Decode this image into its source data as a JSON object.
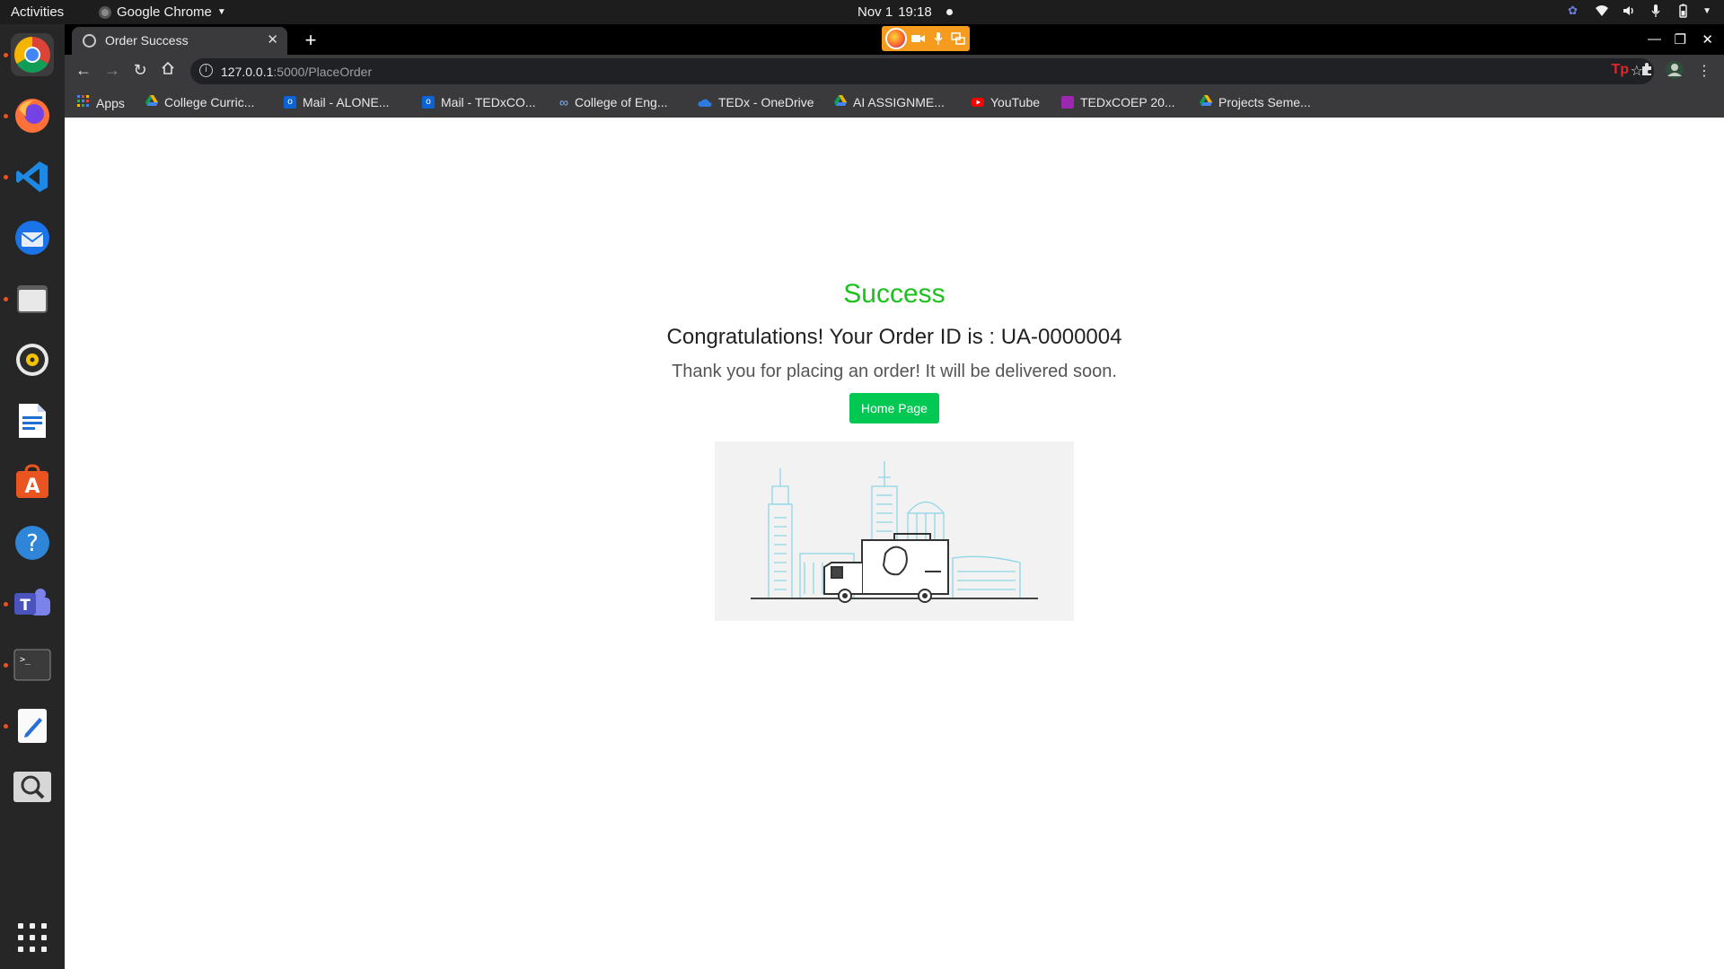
{
  "topbar": {
    "activities": "Activities",
    "app_name": "Google Chrome",
    "date": "Nov 1",
    "time": "19:18"
  },
  "dock": {
    "items": [
      "chrome-icon",
      "firefox-icon",
      "vscode-icon",
      "thunderbird-icon",
      "files-icon",
      "rhythmbox-icon",
      "libreoffice-writer-icon",
      "software-center-icon",
      "help-icon",
      "teams-icon",
      "terminal-icon",
      "text-editor-icon",
      "search-magnifier-icon"
    ]
  },
  "browser": {
    "tab_title": "Order Success",
    "url_host": "127.0.0.1",
    "url_path": ":5000/PlaceOrder",
    "bookmarks": [
      {
        "label": "Apps",
        "color": "#4285f4"
      },
      {
        "label": "College Curric...",
        "color": "#f4b400"
      },
      {
        "label": "Mail - ALONE...",
        "color": "#0a64d6"
      },
      {
        "label": "Mail - TEDxCO...",
        "color": "#0a64d6"
      },
      {
        "label": "College of Eng...",
        "color": "#8ab4f8"
      },
      {
        "label": "TEDx - OneDrive",
        "color": "#2d7be0"
      },
      {
        "label": "AI ASSIGNME...",
        "color": "#0f9d58"
      },
      {
        "label": "YouTube",
        "color": "#ff0000"
      },
      {
        "label": "TEDxCOEP 20...",
        "color": "#9c27b0"
      },
      {
        "label": "Projects Seme...",
        "color": "#f4b400"
      }
    ]
  },
  "page": {
    "heading": "Success",
    "congrats": "Congratulations! Your Order ID is : UA-0000004",
    "thanks": "Thank you for placing an order! It will be delivered soon.",
    "home_button": "Home Page"
  },
  "colors": {
    "success_green": "#1cc11c",
    "button_green": "#00c853",
    "illustration_line": "#8fd6e6"
  }
}
